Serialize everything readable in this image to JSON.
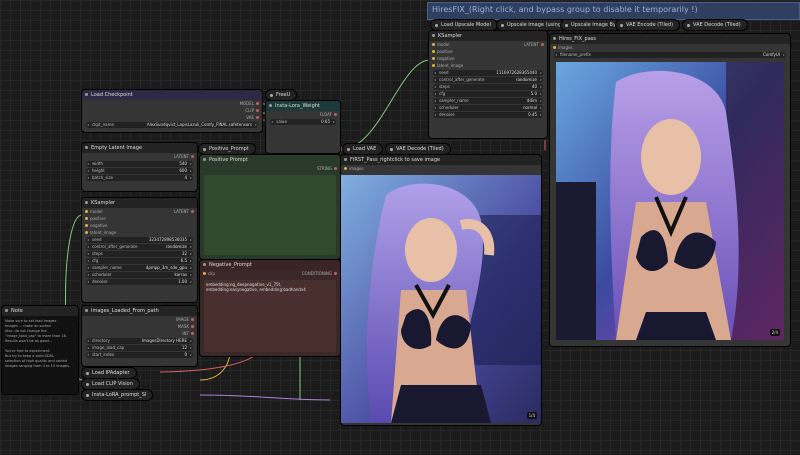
{
  "group": {
    "title": "HiresFIX_(Right click, and bypass group to disable it temporarily !)"
  },
  "nodes": {
    "load_checkpoint": {
      "title": "Load Checkpoint",
      "outputs": [
        "MODEL",
        "CLIP",
        "VAE"
      ],
      "ckpt_label": "ckpt_name",
      "ckpt_value": "AlexSundqvist_LapisLazuli_Comfy_FINAL.safetensors"
    },
    "freeu": {
      "title": "FreeU"
    },
    "insta_lora": {
      "title": "Insta-Lora_Weight",
      "output": "FLOAT",
      "value_label": "value",
      "value": "0.65"
    },
    "empty_latent": {
      "title": "Empty Latent Image",
      "output": "LATENT",
      "width_label": "width",
      "width": "540",
      "height_label": "height",
      "height": "600",
      "batch_label": "batch_size",
      "batch": "4"
    },
    "positive_prompt_1": {
      "title": "Positive_Prompt"
    },
    "positive_prompt_2": {
      "title": "Positive Prompt",
      "output": "STRING"
    },
    "ksampler": {
      "title": "KSampler",
      "inputs": [
        "model",
        "positive",
        "negative",
        "latent_image"
      ],
      "output": "LATENT",
      "widgets": [
        {
          "l": "seed",
          "v": "323472898536035"
        },
        {
          "l": "control_after_generate",
          "v": "randomize"
        },
        {
          "l": "steps",
          "v": "32"
        },
        {
          "l": "cfg",
          "v": "6.5"
        },
        {
          "l": "sampler_name",
          "v": "dpmpp_3m_sde_gpu"
        },
        {
          "l": "scheduler",
          "v": "karras"
        },
        {
          "l": "denoise",
          "v": "1.00"
        }
      ]
    },
    "negative_prompt": {
      "title": "Negative_Prompt",
      "input": "clip",
      "output": "CONDITIONING",
      "text": "embedding:ng_deepnegative_v1_75t, embedding:easynegative, embedding:badhandv4"
    },
    "load_vae": {
      "title": "Load VAE"
    },
    "vae_decode": {
      "title": "VAE Decode (Tiled)"
    },
    "first_pass": {
      "title": "FIRST_Pass_rightclick to save image",
      "input": "images",
      "counter": "1/4"
    },
    "ksampler_hires": {
      "title": "KSampler",
      "inputs": [
        "model",
        "positive",
        "negative",
        "latent_image"
      ],
      "output": "LATENT",
      "widgets": [
        {
          "l": "seed",
          "v": "1116972628365440"
        },
        {
          "l": "control_after_generate",
          "v": "randomize"
        },
        {
          "l": "steps",
          "v": "40"
        },
        {
          "l": "cfg",
          "v": "5.0"
        },
        {
          "l": "sampler_name",
          "v": "ddim"
        },
        {
          "l": "scheduler",
          "v": "normal"
        },
        {
          "l": "denoise",
          "v": "0.45"
        }
      ]
    },
    "hires_collapsed": [
      {
        "title": "Load Upscale Model"
      },
      {
        "title": "Upscale Image (using"
      },
      {
        "title": "Upscale Image By"
      },
      {
        "title": "VAE Encode (Tiled)"
      },
      {
        "title": "VAE Decode (Tiled)"
      }
    ],
    "hires_pass": {
      "title": "Hires_FIX_pass",
      "input": "images",
      "filename_label": "filename_prefix",
      "filename_value": "ComfyUI",
      "counter": "2/4"
    },
    "note": {
      "title": "Note",
      "lines": [
        "Make sure to set load images",
        "Images ... make an sorted",
        "Also, do not change the",
        "\"image_load_cap\" to more than 18.",
        "Results won't be as good...",
        "",
        "You're free to experiment.",
        "But try to keep a solid SDXL",
        "selection of high quality and varied",
        "images ranging from 4 to 10 images."
      ]
    },
    "images_from_path": {
      "title": "Images_Loaded_From_path",
      "outputs": [
        "IMAGE",
        "MASK",
        "INT"
      ],
      "widgets": [
        {
          "l": "directory",
          "v": "ImagesDirectory HERE"
        },
        {
          "l": "image_load_cap",
          "v": "12"
        },
        {
          "l": "start_index",
          "v": "0"
        }
      ]
    },
    "load_ipadapter": {
      "title": "Load IPAdapter"
    },
    "load_clip_vision": {
      "title": "Load CLIP Vision"
    },
    "insta_lora_prompt": {
      "title": "Insta-LoRA_prompt_SI"
    }
  },
  "colors": {
    "canvas": "#1b1b1b",
    "group": "#2f3f5f",
    "wire_green": "#7fc77f",
    "wire_yellow": "#e0b040",
    "wire_red": "#d06060",
    "wire_purple": "#b080e0"
  }
}
